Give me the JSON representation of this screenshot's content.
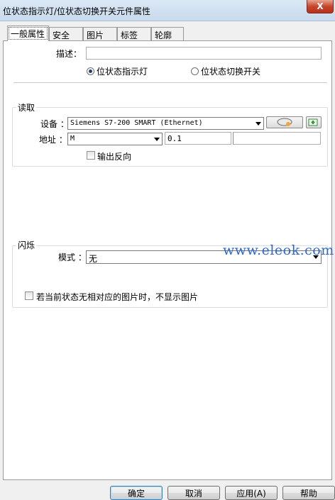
{
  "window": {
    "title": "位状态指示灯/位状态切换开关元件属性",
    "close_label": "X"
  },
  "tabs": [
    {
      "label": "一般属性",
      "active": true
    },
    {
      "label": "安全"
    },
    {
      "label": "图片"
    },
    {
      "label": "标签"
    },
    {
      "label": "轮廓"
    }
  ],
  "general": {
    "description_label": "描述：",
    "description_value": "",
    "type_options": [
      {
        "label": "位状态指示灯",
        "selected": true
      },
      {
        "label": "位状态切换开关",
        "selected": false
      }
    ]
  },
  "read_group": {
    "title": "读取",
    "device_label": "设备 ：",
    "device_value": "Siemens S7-200 SMART (Ethernet)",
    "address_label": "地址 ：",
    "address_type": "M",
    "address_value": "0.1",
    "invert_label": "输出反向",
    "invert_checked": false
  },
  "blink_group": {
    "title": "闪烁",
    "mode_label": "模式 ：",
    "mode_value": "无",
    "hide_label": "若当前状态无相对应的图片时，不显示图片",
    "hide_checked": false
  },
  "watermark": "www.eleok.com",
  "buttons": {
    "ok": "确定",
    "cancel": "取消",
    "apply": "应用(A)",
    "help": "帮助"
  }
}
